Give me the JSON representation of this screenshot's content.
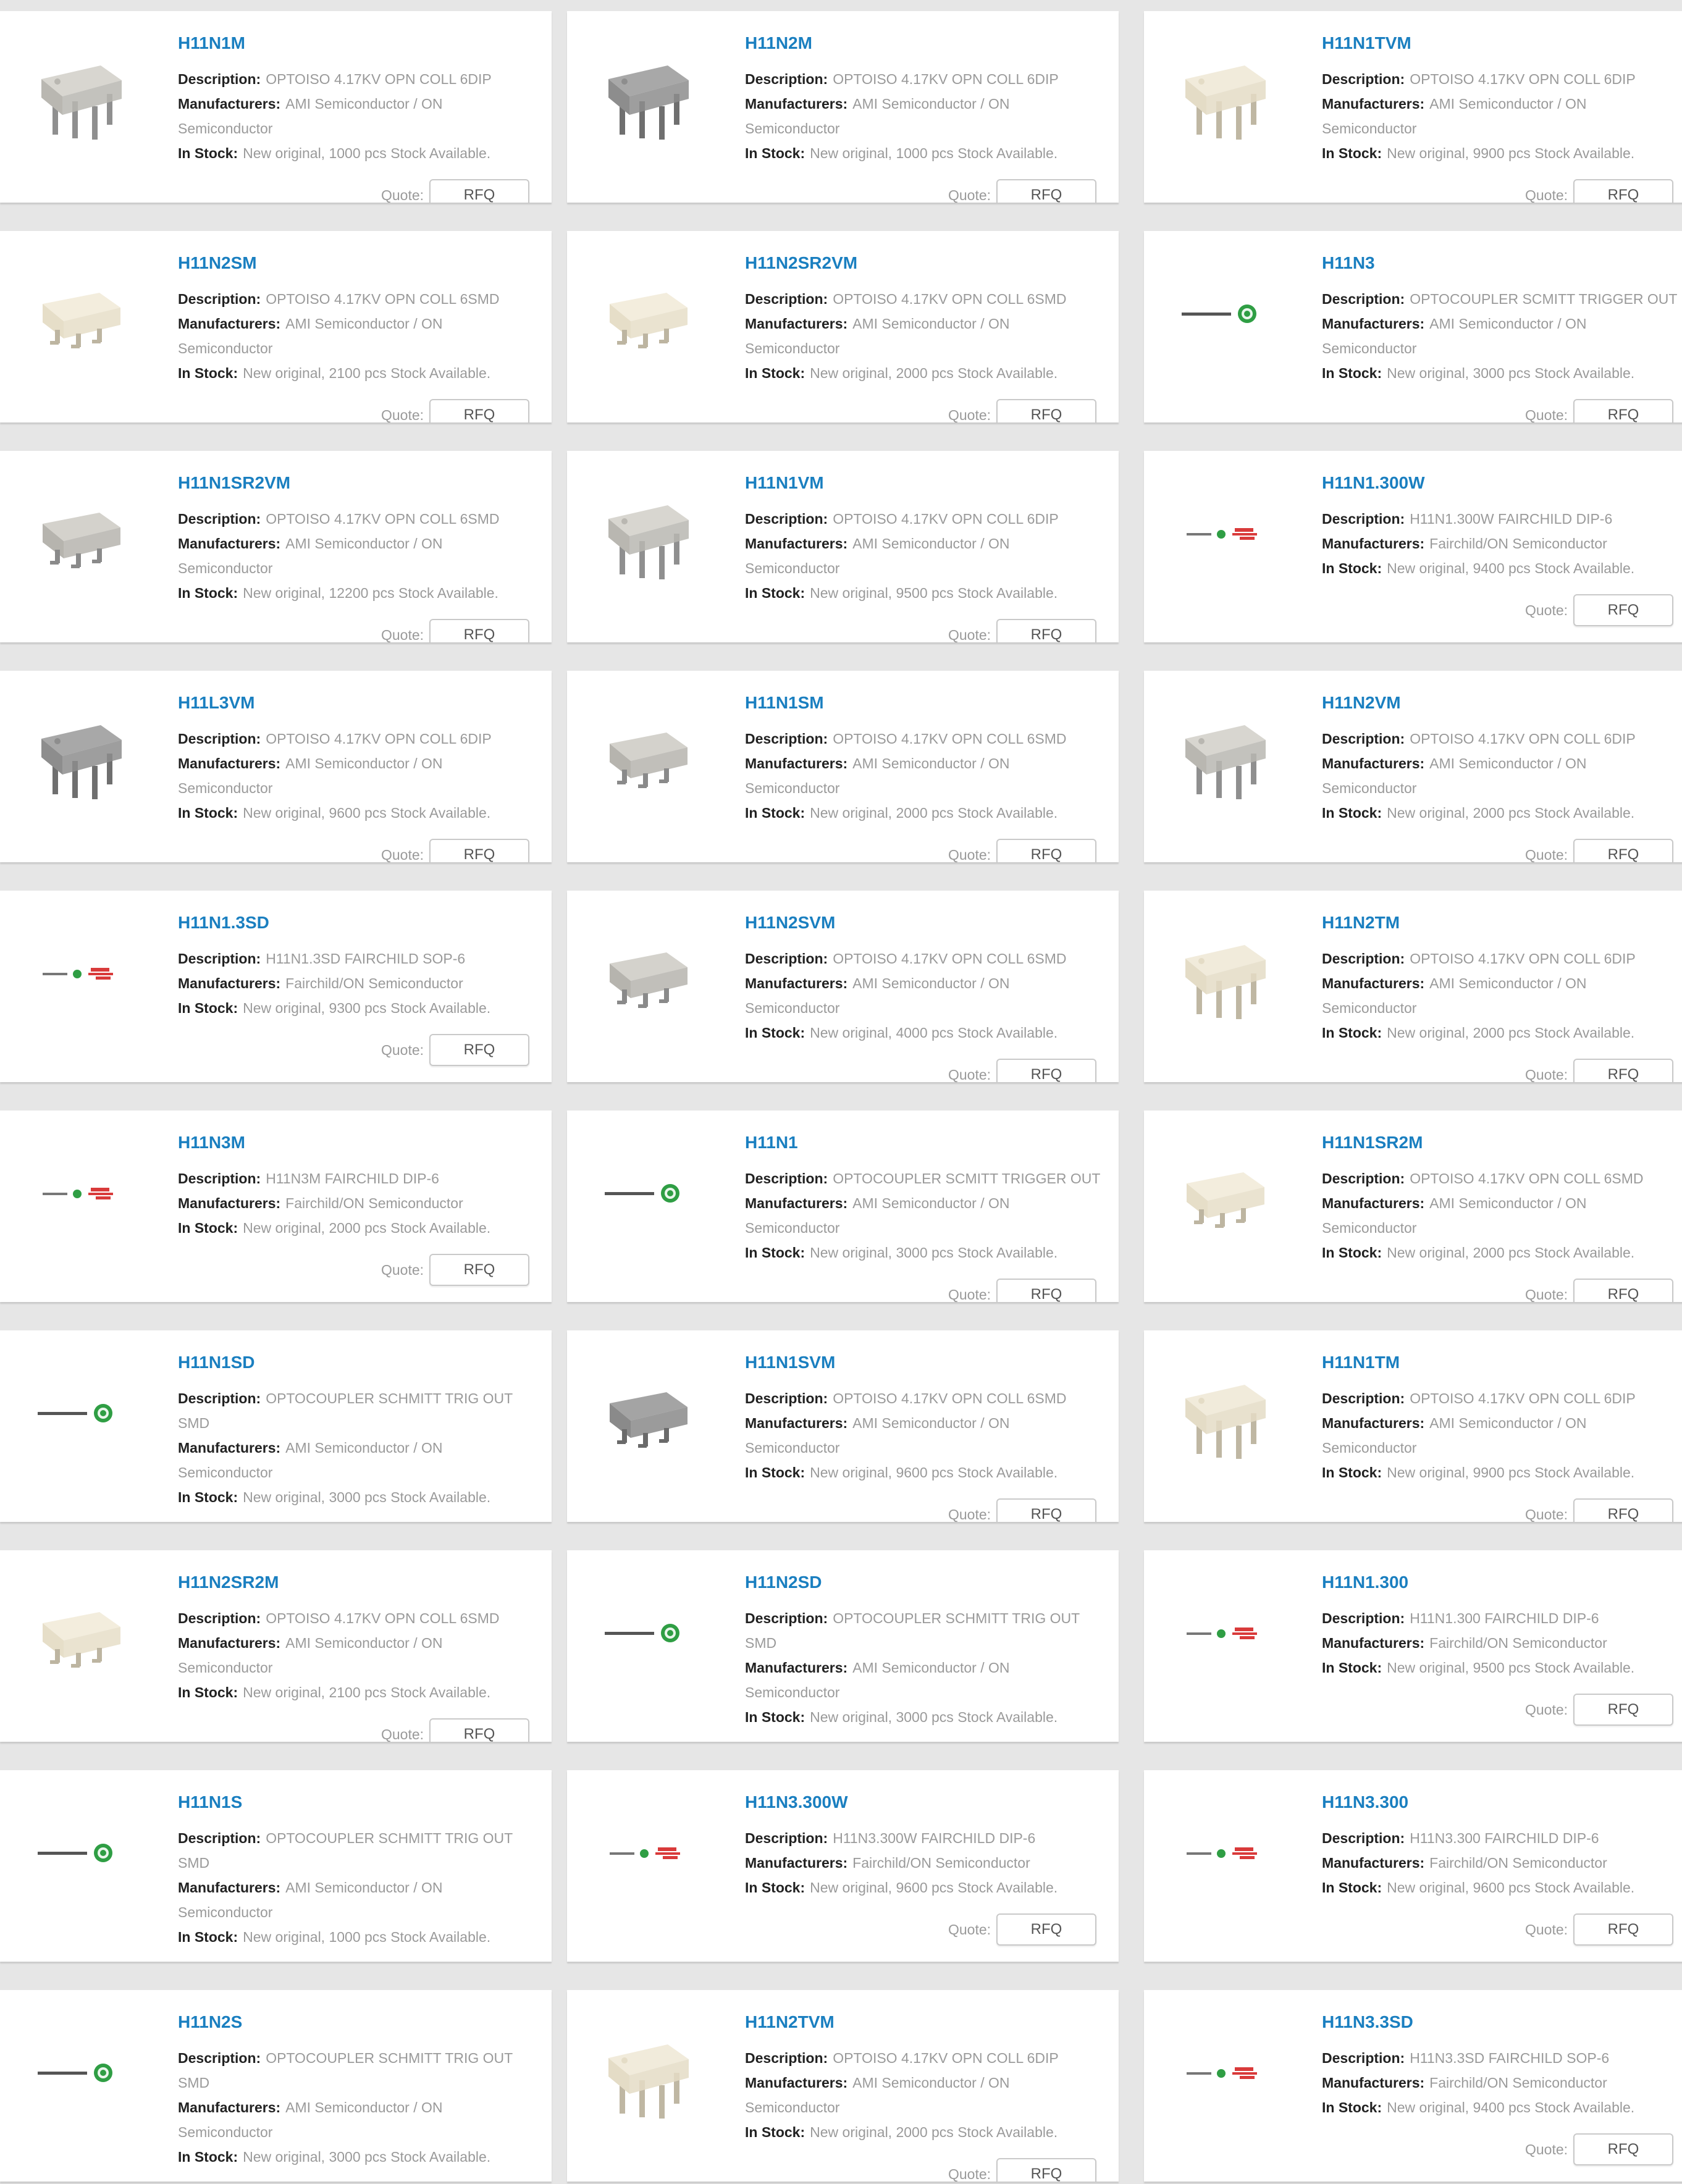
{
  "labels": {
    "description": "Description:",
    "manufacturers": "Manufacturers:",
    "in_stock": "In Stock:",
    "quote": "Quote:",
    "rfq": "RFQ"
  },
  "products": [
    {
      "part": "H11N1M",
      "description": [
        "OPTOISO 4.17KV OPN COLL 6DIP"
      ],
      "manufacturers": [
        "AMI Semiconductor / ON",
        "Semiconductor"
      ],
      "stock": "New original, 1000 pcs Stock Available.",
      "image": "dip-grey"
    },
    {
      "part": "H11N2M",
      "description": [
        "OPTOISO 4.17KV OPN COLL 6DIP"
      ],
      "manufacturers": [
        "AMI Semiconductor / ON",
        "Semiconductor"
      ],
      "stock": "New original, 1000 pcs Stock Available.",
      "image": "dip-dark"
    },
    {
      "part": "H11N1TVM",
      "description": [
        "OPTOISO 4.17KV OPN COLL 6DIP"
      ],
      "manufacturers": [
        "AMI Semiconductor / ON",
        "Semiconductor"
      ],
      "stock": "New original, 9900 pcs Stock Available.",
      "image": "dip-cream"
    },
    {
      "part": "H11N2SM",
      "description": [
        "OPTOISO 4.17KV OPN COLL 6SMD"
      ],
      "manufacturers": [
        "AMI Semiconductor / ON",
        "Semiconductor"
      ],
      "stock": "New original, 2100 pcs Stock Available.",
      "image": "smd-cream"
    },
    {
      "part": "H11N2SR2VM",
      "description": [
        "OPTOISO 4.17KV OPN COLL 6SMD"
      ],
      "manufacturers": [
        "AMI Semiconductor / ON",
        "Semiconductor"
      ],
      "stock": "New original, 2000 pcs Stock Available.",
      "image": "smd-cream"
    },
    {
      "part": "H11N3",
      "description": [
        "OPTOCOUPLER SCMITT TRIGGER OUT"
      ],
      "manufacturers": [
        "AMI Semiconductor / ON",
        "Semiconductor"
      ],
      "stock": "New original, 3000 pcs Stock Available.",
      "image": "logo-on"
    },
    {
      "part": "H11N1SR2VM",
      "description": [
        "OPTOISO 4.17KV OPN COLL 6SMD"
      ],
      "manufacturers": [
        "AMI Semiconductor / ON",
        "Semiconductor"
      ],
      "stock": "New original, 12200 pcs Stock Available.",
      "image": "smd-grey"
    },
    {
      "part": "H11N1VM",
      "description": [
        "OPTOISO 4.17KV OPN COLL 6DIP"
      ],
      "manufacturers": [
        "AMI Semiconductor / ON",
        "Semiconductor"
      ],
      "stock": "New original, 9500 pcs Stock Available.",
      "image": "dip-grey"
    },
    {
      "part": "H11N1.300W",
      "description": [
        "H11N1.300W FAIRCHILD DIP-6"
      ],
      "manufacturers": [
        "Fairchild/ON Semiconductor"
      ],
      "stock": "New original, 9400 pcs Stock Available.",
      "image": "logo-fairchild"
    },
    {
      "part": "H11L3VM",
      "description": [
        "OPTOISO 4.17KV OPN COLL 6DIP"
      ],
      "manufacturers": [
        "AMI Semiconductor / ON",
        "Semiconductor"
      ],
      "stock": "New original, 9600 pcs Stock Available.",
      "image": "dip-dark"
    },
    {
      "part": "H11N1SM",
      "description": [
        "OPTOISO 4.17KV OPN COLL 6SMD"
      ],
      "manufacturers": [
        "AMI Semiconductor / ON",
        "Semiconductor"
      ],
      "stock": "New original, 2000 pcs Stock Available.",
      "image": "smd-grey"
    },
    {
      "part": "H11N2VM",
      "description": [
        "OPTOISO 4.17KV OPN COLL 6DIP"
      ],
      "manufacturers": [
        "AMI Semiconductor / ON",
        "Semiconductor"
      ],
      "stock": "New original, 2000 pcs Stock Available.",
      "image": "dip-grey"
    },
    {
      "part": "H11N1.3SD",
      "description": [
        "H11N1.3SD FAIRCHILD SOP-6"
      ],
      "manufacturers": [
        "Fairchild/ON Semiconductor"
      ],
      "stock": "New original, 9300 pcs Stock Available.",
      "image": "logo-fairchild"
    },
    {
      "part": "H11N2SVM",
      "description": [
        "OPTOISO 4.17KV OPN COLL 6SMD"
      ],
      "manufacturers": [
        "AMI Semiconductor / ON",
        "Semiconductor"
      ],
      "stock": "New original, 4000 pcs Stock Available.",
      "image": "smd-grey"
    },
    {
      "part": "H11N2TM",
      "description": [
        "OPTOISO 4.17KV OPN COLL 6DIP"
      ],
      "manufacturers": [
        "AMI Semiconductor / ON",
        "Semiconductor"
      ],
      "stock": "New original, 2000 pcs Stock Available.",
      "image": "dip-cream"
    },
    {
      "part": "H11N3M",
      "description": [
        "H11N3M FAIRCHILD DIP-6"
      ],
      "manufacturers": [
        "Fairchild/ON Semiconductor"
      ],
      "stock": "New original, 2000 pcs Stock Available.",
      "image": "logo-fairchild"
    },
    {
      "part": "H11N1",
      "description": [
        "OPTOCOUPLER SCMITT TRIGGER OUT"
      ],
      "manufacturers": [
        "AMI Semiconductor / ON",
        "Semiconductor"
      ],
      "stock": "New original, 3000 pcs Stock Available.",
      "image": "logo-on"
    },
    {
      "part": "H11N1SR2M",
      "description": [
        "OPTOISO 4.17KV OPN COLL 6SMD"
      ],
      "manufacturers": [
        "AMI Semiconductor / ON",
        "Semiconductor"
      ],
      "stock": "New original, 2000 pcs Stock Available.",
      "image": "smd-cream"
    },
    {
      "part": "H11N1SD",
      "description": [
        "OPTOCOUPLER SCHMITT TRIG OUT",
        "SMD"
      ],
      "manufacturers": [
        "AMI Semiconductor / ON",
        "Semiconductor"
      ],
      "stock": "New original, 3000 pcs Stock Available.",
      "image": "logo-on"
    },
    {
      "part": "H11N1SVM",
      "description": [
        "OPTOISO 4.17KV OPN COLL 6SMD"
      ],
      "manufacturers": [
        "AMI Semiconductor / ON",
        "Semiconductor"
      ],
      "stock": "New original, 9600 pcs Stock Available.",
      "image": "smd-dark"
    },
    {
      "part": "H11N1TM",
      "description": [
        "OPTOISO 4.17KV OPN COLL 6DIP"
      ],
      "manufacturers": [
        "AMI Semiconductor / ON",
        "Semiconductor"
      ],
      "stock": "New original, 9900 pcs Stock Available.",
      "image": "dip-cream"
    },
    {
      "part": "H11N2SR2M",
      "description": [
        "OPTOISO 4.17KV OPN COLL 6SMD"
      ],
      "manufacturers": [
        "AMI Semiconductor / ON",
        "Semiconductor"
      ],
      "stock": "New original, 2100 pcs Stock Available.",
      "image": "smd-cream"
    },
    {
      "part": "H11N2SD",
      "description": [
        "OPTOCOUPLER SCHMITT TRIG OUT",
        "SMD"
      ],
      "manufacturers": [
        "AMI Semiconductor / ON",
        "Semiconductor"
      ],
      "stock": "New original, 3000 pcs Stock Available.",
      "image": "logo-on"
    },
    {
      "part": "H11N1.300",
      "description": [
        "H11N1.300 FAIRCHILD DIP-6"
      ],
      "manufacturers": [
        "Fairchild/ON Semiconductor"
      ],
      "stock": "New original, 9500 pcs Stock Available.",
      "image": "logo-fairchild"
    },
    {
      "part": "H11N1S",
      "description": [
        "OPTOCOUPLER SCHMITT TRIG OUT",
        "SMD"
      ],
      "manufacturers": [
        "AMI Semiconductor / ON",
        "Semiconductor"
      ],
      "stock": "New original, 1000 pcs Stock Available.",
      "image": "logo-on"
    },
    {
      "part": "H11N3.300W",
      "description": [
        "H11N3.300W FAIRCHILD DIP-6"
      ],
      "manufacturers": [
        "Fairchild/ON Semiconductor"
      ],
      "stock": "New original, 9600 pcs Stock Available.",
      "image": "logo-fairchild"
    },
    {
      "part": "H11N3.300",
      "description": [
        "H11N3.300 FAIRCHILD DIP-6"
      ],
      "manufacturers": [
        "Fairchild/ON Semiconductor"
      ],
      "stock": "New original, 9600 pcs Stock Available.",
      "image": "logo-fairchild"
    },
    {
      "part": "H11N2S",
      "description": [
        "OPTOCOUPLER SCHMITT TRIG OUT",
        "SMD"
      ],
      "manufacturers": [
        "AMI Semiconductor / ON",
        "Semiconductor"
      ],
      "stock": "New original, 3000 pcs Stock Available.",
      "image": "logo-on"
    },
    {
      "part": "H11N2TVM",
      "description": [
        "OPTOISO 4.17KV OPN COLL 6DIP"
      ],
      "manufacturers": [
        "AMI Semiconductor / ON",
        "Semiconductor"
      ],
      "stock": "New original, 2000 pcs Stock Available.",
      "image": "dip-cream"
    },
    {
      "part": "H11N3.3SD",
      "description": [
        "H11N3.3SD FAIRCHILD SOP-6"
      ],
      "manufacturers": [
        "Fairchild/ON Semiconductor"
      ],
      "stock": "New original, 9400 pcs Stock Available.",
      "image": "logo-fairchild"
    }
  ]
}
